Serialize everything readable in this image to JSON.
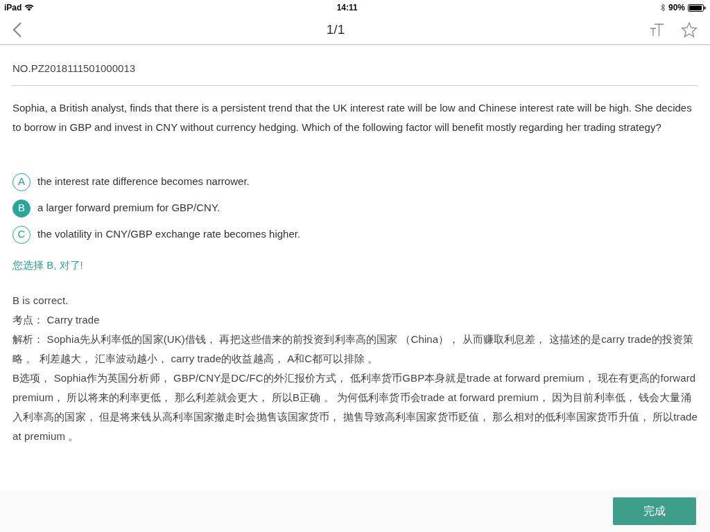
{
  "status_bar": {
    "device": "iPad",
    "time": "14:11",
    "battery": "90%"
  },
  "nav": {
    "title": "1/1"
  },
  "question": {
    "number": "NO.PZ2018111501000013",
    "text": "Sophia, a British analyst, finds that there is a persistent trend that the UK interest rate will be low and Chinese interest rate will be high. She decides to borrow in GBP and invest in CNY without currency hedging. Which of the following factor will benefit mostly regarding her trading strategy?",
    "options": [
      {
        "letter": "A",
        "text": "the interest rate difference becomes narrower.",
        "selected": false
      },
      {
        "letter": "B",
        "text": "a larger forward premium for GBP/CNY.",
        "selected": true
      },
      {
        "letter": "C",
        "text": "the volatility in CNY/GBP exchange rate becomes higher.",
        "selected": false
      }
    ]
  },
  "feedback": "您选择 B, 对了!",
  "explanation": [
    "B is correct.",
    "考点： Carry trade",
    "解析： Sophia先从利率低的国家(UK)借钱， 再把这些借来的前投资到利率高的国家 （China）， 从而赚取利息差， 这描述的是carry trade的投资策略 。 利差越大， 汇率波动越小， carry trade的收益越高， A和C都可以排除 。",
    "B选项， Sophia作为英国分析师， GBP/CNY是DC/FC的外汇报价方式， 低利率货币GBP本身就是trade at forward premium， 现在有更高的forward premium， 所以将来的利率更低， 那么利差就会更大， 所以B正确 。 为何低利率货币会trade at forward premium， 因为目前利率低， 钱会大量涌入利率高的国家， 但是将来钱从高利率国家撤走时会抛售该国家货币， 抛售导致高利率国家货币贬值， 那么相对的低利率国家货币升值， 所以trade at premium 。"
  ],
  "footer": {
    "button": "完成"
  }
}
